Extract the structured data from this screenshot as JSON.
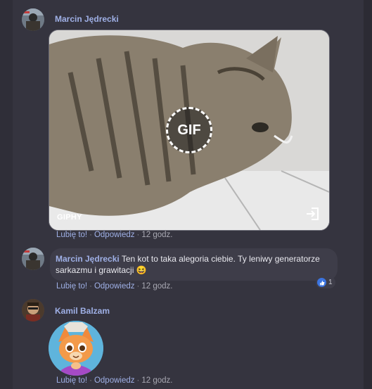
{
  "comments": [
    {
      "author": "Marcin Jędrecki",
      "attachment": {
        "type": "gif",
        "badge": "GIF",
        "provider": "GIPHY",
        "expand_icon": "expand-out-icon"
      },
      "actions": {
        "like": "Lubię to!",
        "reply": "Odpowiedz",
        "time": "12 godz."
      }
    },
    {
      "author": "Marcin Jędrecki",
      "text": "Ten kot to taka alegoria ciebie. Ty leniwy generatorze sarkazmu i grawitacji",
      "emoji": "😆",
      "reaction": {
        "icon": "like-icon",
        "count": "1"
      },
      "actions": {
        "like": "Lubię to!",
        "reply": "Odpowiedz",
        "time": "12 godz."
      }
    },
    {
      "author": "Kamil Balzam",
      "attachment": {
        "type": "sticker",
        "icon": "cartoon-fox-sticker"
      },
      "actions": {
        "like": "Lubię to!",
        "reply": "Odpowiedz",
        "time": "12 godz."
      }
    }
  ],
  "colors": {
    "background": "#35343f",
    "author": "#9fb0e6",
    "bubble": "#3e3d49",
    "like": "#3b74e0"
  }
}
